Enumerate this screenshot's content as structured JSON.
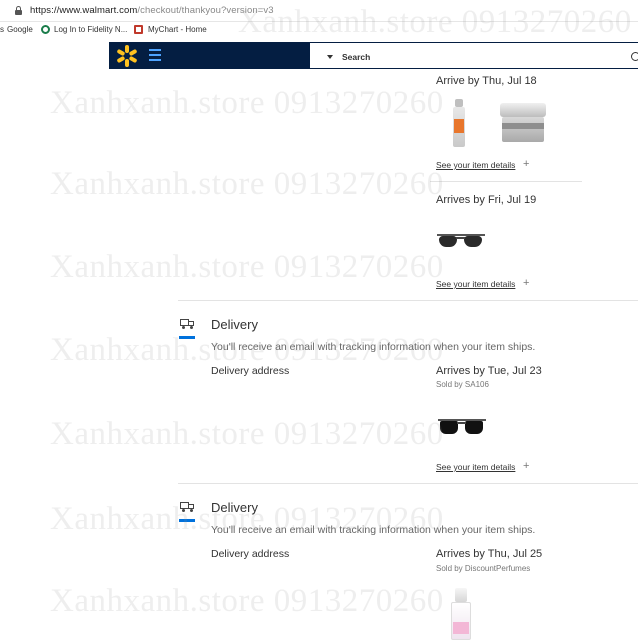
{
  "browser": {
    "url_main": "https://www.walmart.com",
    "url_path": "/checkout/thankyou?version=v3",
    "bookmarks": [
      {
        "label": "Google"
      },
      {
        "label": "Log In to Fidelity N..."
      },
      {
        "label": "MyChart - Home"
      }
    ]
  },
  "header": {
    "search_label": "Search"
  },
  "shipments": [
    {
      "arrive": "Arrive by Thu, Jul 18",
      "link": "See your item details"
    },
    {
      "arrive": "Arrives by Fri, Jul 19",
      "link": "See your item details"
    }
  ],
  "deliveries": [
    {
      "title": "Delivery",
      "subtitle": "You'll receive an email with tracking information when your item ships.",
      "address_label": "Delivery address",
      "arrive": "Arrives by Tue, Jul 23",
      "sold_by": "Sold by SA106",
      "link": "See your item details"
    },
    {
      "title": "Delivery",
      "subtitle": "You'll receive an email with tracking information when your item ships.",
      "address_label": "Delivery address",
      "arrive": "Arrives by Thu, Jul 25",
      "sold_by": "Sold by DiscountPerfumes"
    }
  ],
  "watermark": "Xanhxanh.store 0913270260",
  "colors": {
    "walmart_navy": "#041e42",
    "spark_yellow": "#ffc220",
    "accent_blue": "#0071dc"
  }
}
